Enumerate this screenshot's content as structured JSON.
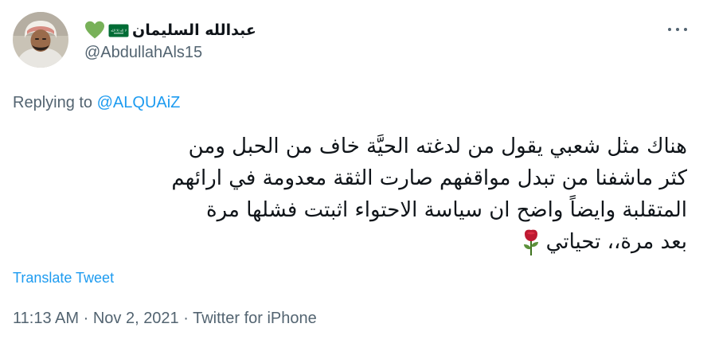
{
  "author": {
    "display_name": "عبدالله السليمان",
    "handle": "@AbdullahAls15",
    "flag_text": "لا إله إلا الله"
  },
  "reply": {
    "prefix": "Replying to",
    "mention": "@ALQUAiZ"
  },
  "tweet": {
    "lines": [
      "هناك مثل شعبي يقول من لدغته الحيَّة خاف من الحبل ومن",
      "كثر ماشفنا من تبدل مواقفهم صارت الثقة معدومة في ارائهم",
      "المتقلبة وايضاً واضح ان سياسة الاحتواء اثبتت فشلها مرة",
      "بعد مرة،، تحياتي"
    ]
  },
  "translate_label": "Translate Tweet",
  "meta": {
    "time": "11:13 AM",
    "separator": "·",
    "date": "Nov 2, 2021",
    "source": "Twitter for iPhone"
  },
  "icons": {
    "heart": "green-heart-icon",
    "flag": "saudi-flag-icon",
    "rose": "rose-icon",
    "more": "more-options-icon"
  },
  "colors": {
    "link": "#1d9bf0",
    "secondary_text": "#536471",
    "primary_text": "#0f1419",
    "heart": "#78b159",
    "flag": "#006c35",
    "rose": "#be1931"
  }
}
